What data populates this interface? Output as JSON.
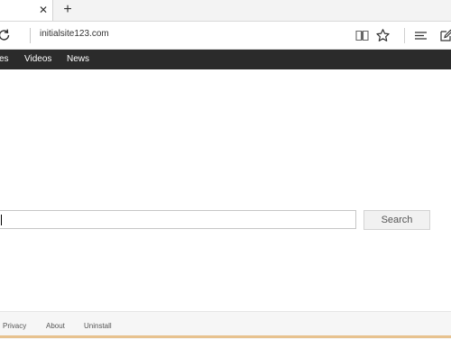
{
  "browser": {
    "tab_close_glyph": "✕",
    "new_tab_glyph": "+",
    "address": "initialsite123.com",
    "icons": [
      "refresh-icon",
      "reading-view-icon",
      "favorite-star-icon",
      "hub-icon",
      "web-note-icon"
    ]
  },
  "site_nav": {
    "items": [
      "es",
      "Videos",
      "News"
    ]
  },
  "search": {
    "input_value": "",
    "button_label": "Search"
  },
  "footer": {
    "links": [
      "Privacy",
      "About",
      "Uninstall"
    ]
  },
  "colors": {
    "nav_background": "#2b2b2b",
    "bottom_accent": "#e7c28f"
  }
}
